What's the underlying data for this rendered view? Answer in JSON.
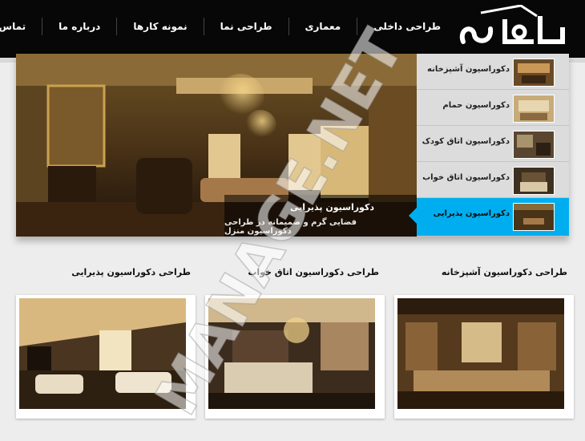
{
  "nav": {
    "items": [
      "طراحی داخلی",
      "معماری",
      "طراحی نما",
      "نمونه کارها",
      "درباره ما",
      "تماس با ما"
    ]
  },
  "logo": {
    "text": "رسور"
  },
  "slider": {
    "caption_title": "دکوراسیون پذیرایی",
    "caption_subtitle": "فضایی گرم و صمیمانه در طراحی دکوراسیون منزل",
    "prev_label": "›",
    "next_label": "‹"
  },
  "thumbs": {
    "items": [
      {
        "label": "دکوراسیون آشپزخانه",
        "active": false
      },
      {
        "label": "دکوراسیون حمام",
        "active": false
      },
      {
        "label": "دکوراسیون اتاق کودک",
        "active": false
      },
      {
        "label": "دکوراسیون اتاق خواب",
        "active": false
      },
      {
        "label": "دکوراسیون پذیرایی",
        "active": true
      }
    ]
  },
  "sections": {
    "kitchen": "طراحی دکوراسیون آشپزخانه",
    "bedroom": "طراحی دکوراسیون اتاق خواب",
    "living": "طراحی دکوراسیون پذیرایی"
  },
  "watermark": {
    "text": "MANAGE.NET"
  },
  "colors": {
    "topbar": "#070707",
    "accent": "#00aeef",
    "page_bg": "#ededed"
  }
}
